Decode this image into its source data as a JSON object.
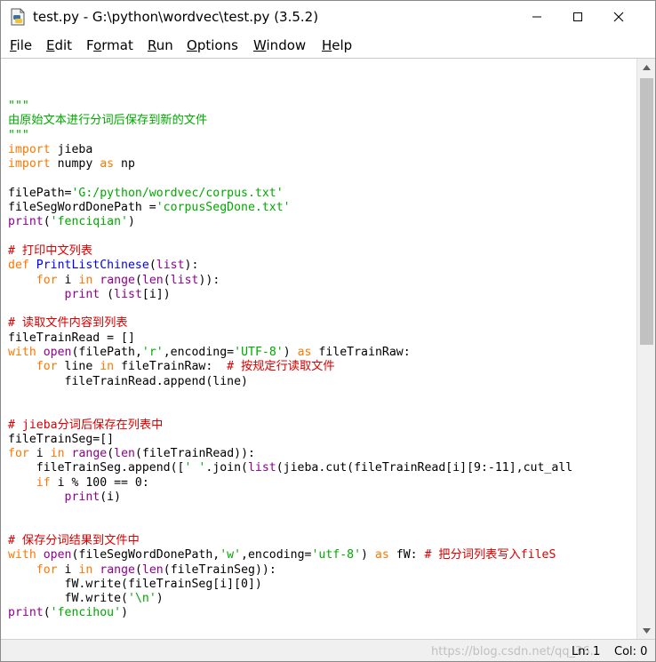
{
  "window": {
    "title": "test.py - G:\\python\\wordvec\\test.py (3.5.2)"
  },
  "menu": [
    {
      "acc": "F",
      "rest": "ile"
    },
    {
      "acc": "E",
      "rest": "dit"
    },
    {
      "pre": "F",
      "acc": "o",
      "rest": "rmat"
    },
    {
      "acc": "R",
      "rest": "un"
    },
    {
      "acc": "O",
      "rest": "ptions"
    },
    {
      "acc": "W",
      "rest": "indow"
    },
    {
      "acc": "H",
      "rest": "elp"
    }
  ],
  "code": {
    "line1": "\"\"\"",
    "line2": "由原始文本进行分词后保存到新的文件",
    "line3": "\"\"\"",
    "import1_kw": "import",
    "import1_mod": " jieba",
    "import2_kw": "import",
    "import2_mod": " numpy ",
    "import2_as": "as",
    "import2_alias": " np",
    "fp_assign": "filePath=",
    "fp_str": "'G:/python/wordvec/corpus.txt'",
    "fsd_assign": "fileSegWordDonePath =",
    "fsd_str": "'corpusSegDone.txt'",
    "print": "print",
    "p1_open": "(",
    "p1_str": "'fenciqian'",
    "p1_close": ")",
    "c1": "# 打印中文列表",
    "def": "def",
    "fn_name": "PrintListChinese",
    "fn_paren": "(",
    "list": "list",
    "fn_tail": "):",
    "for": "for",
    "in": "in",
    "range": "range",
    "len": "len",
    "l9_i": " i ",
    "l9_open": "(",
    "l9_arg_open": "(",
    "l9_tail": ")):",
    "l10_open": " (",
    "l10_tail": "[i])",
    "c2": "# 读取文件内容到列表",
    "ftr_assign": "fileTrainRead = []",
    "with": "with",
    "open": "open",
    "w1_args": "(filePath,",
    "w1_r": "'r'",
    "w1_enc": ",encoding=",
    "w1_utf": "'UTF-8'",
    "w1_close": ") ",
    "as": "as",
    "w1_tail": " fileTrainRaw:",
    "l15_line": " line ",
    "l15_mid": " fileTrainRaw:  ",
    "c3": "# 按规定行读取文件",
    "l16": "fileTrainRead.append(line)",
    "c4": "# jieba分词后保存在列表中",
    "fts_assign": "fileTrainSeg=[]",
    "l19_arg": "(fileTrainRead)):",
    "l20_pre": "fileTrainSeg.append([",
    "l20_space": "' '",
    "l20_mid": ".join(",
    "l20_tail": "(jieba.cut(fileTrainRead[i][9:-11],cut_all",
    "if": "if",
    "l21_tail": " i % 100 == 0:",
    "l22_tail": "(i)",
    "c5": "# 保存分词结果到文件中",
    "w2_args": "(fileSegWordDonePath,",
    "w2_w": "'w'",
    "w2_enc": ",encoding=",
    "w2_utf": "'utf-8'",
    "w2_close": ") ",
    "w2_mid": " fW: ",
    "c6": "# 把分词列表写入fileS",
    "l26_arg": "(fileTrainSeg)):",
    "l27": "fW.write(fileTrainSeg[i][0])",
    "l28_pre": "fW.write(",
    "l28_str": "'\\n'",
    "l28_close": ")",
    "p2_str": "'fencihou'"
  },
  "status": {
    "ln": "Ln: 1",
    "col": "Col: 0",
    "watermark": "https://blog.csdn.net/qq_36..."
  }
}
